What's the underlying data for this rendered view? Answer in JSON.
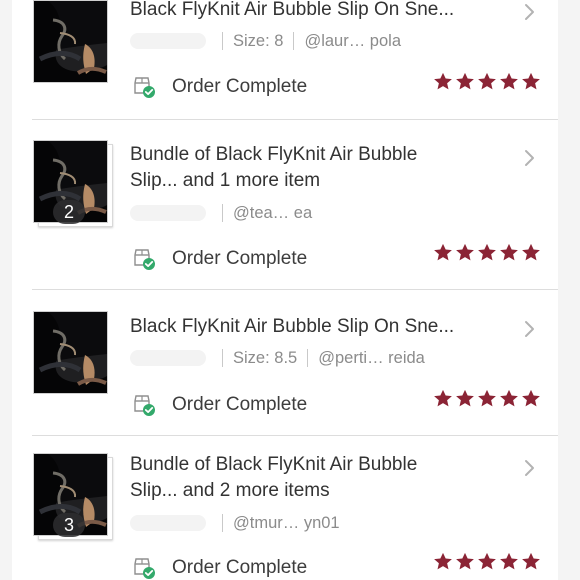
{
  "orders": [
    {
      "title": "Black FlyKnit Air Bubble Slip On Sne...",
      "size_text": "Size: 8",
      "handle": "@laur… pola",
      "status": "Order Complete",
      "rating": 5
    },
    {
      "title_line_1": "Bundle of Black FlyKnit Air Bubble",
      "title_line_2": "Slip... and 1 more item",
      "bundle_count": "2",
      "handle": "@tea… ea",
      "status": "Order Complete",
      "rating": 5
    },
    {
      "title": "Black FlyKnit Air Bubble Slip On Sne...",
      "size_text": "Size: 8.5",
      "handle": "@perti… reida",
      "status": "Order Complete",
      "rating": 5
    },
    {
      "title_line_1": "Bundle of Black FlyKnit Air Bubble",
      "title_line_2": "Slip... and 2 more items",
      "bundle_count": "3",
      "handle": "@tmur… yn01",
      "status": "Order Complete",
      "rating": 5
    }
  ],
  "icons": {
    "status": "order-complete-icon",
    "chevron": "chevron-right-icon",
    "star": "star-icon"
  },
  "colors": {
    "star": "#8b2435",
    "success": "#33a96b",
    "divider": "#dddddd"
  }
}
